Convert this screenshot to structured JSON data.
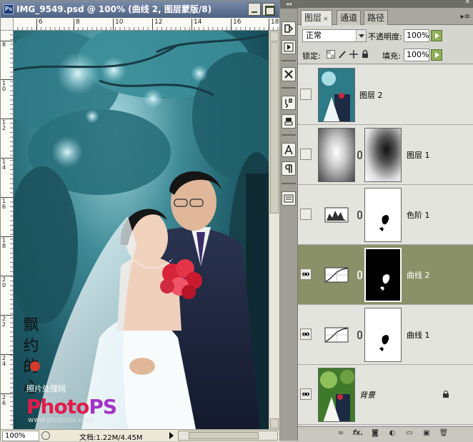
{
  "document": {
    "title": "IMG_9549.psd @ 100% (曲线 2, 图层蒙版/8)",
    "app_icon": "Ps",
    "ruler_top_ticks": [
      "6",
      "8",
      "10",
      "12",
      "14",
      "16",
      "18"
    ],
    "ruler_left_ticks": [
      "8",
      "10",
      "12",
      "14",
      "16",
      "18",
      "20",
      "22",
      "24",
      "26"
    ],
    "zoom": "100%",
    "doc_info": "文档:1.22M/4.45M",
    "watermark": {
      "site_name": "照片处理网",
      "logo_left": "Photo",
      "logo_right": "PS",
      "url": "www.photops.com",
      "calligraphy": "飘 约 的 心"
    }
  },
  "layers_panel": {
    "tabs": [
      "图层",
      "通道",
      "路径"
    ],
    "tab_close": "×",
    "blend_mode": "正常",
    "opacity_label": "不透明度:",
    "opacity_value": "100%",
    "lock_label": "锁定:",
    "fill_label": "填充:",
    "fill_value": "100%",
    "layers": [
      {
        "name": "图层 2",
        "visible": false,
        "selected": false,
        "has_mask": false,
        "adjustment": null
      },
      {
        "name": "图层 1",
        "visible": false,
        "selected": false,
        "has_mask": true,
        "adjustment": "gradient"
      },
      {
        "name": "色阶 1",
        "visible": false,
        "selected": false,
        "has_mask": true,
        "adjustment": "levels"
      },
      {
        "name": "曲线 2",
        "visible": true,
        "selected": true,
        "has_mask": true,
        "adjustment": "curves"
      },
      {
        "name": "曲线 1",
        "visible": true,
        "selected": false,
        "has_mask": true,
        "adjustment": "curves"
      },
      {
        "name": "背景",
        "visible": true,
        "selected": false,
        "has_mask": false,
        "adjustment": null,
        "locked": true
      }
    ],
    "bottom_icons": [
      "link-icon",
      "fx-icon",
      "mask-icon",
      "adjustment-icon",
      "group-icon",
      "new-layer-icon",
      "trash-icon"
    ],
    "bottom_fx": "fx."
  },
  "colors": {
    "selected_layer": "#8a9168",
    "title_bar": "#4e6284",
    "green_button": "#8fae58"
  }
}
